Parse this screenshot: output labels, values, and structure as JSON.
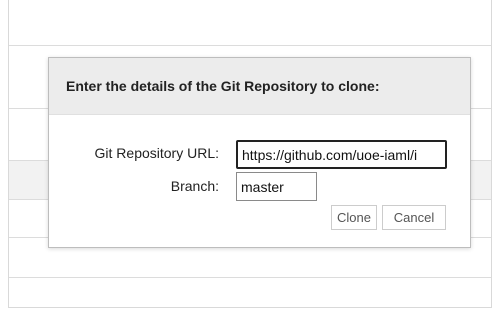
{
  "dialog": {
    "title": "Enter the details of the Git Repository to clone:",
    "url_label": "Git Repository URL:",
    "url_value": "https://github.com/uoe-iaml/i",
    "branch_label": "Branch:",
    "branch_value": "master",
    "clone_label": "Clone",
    "cancel_label": "Cancel"
  }
}
